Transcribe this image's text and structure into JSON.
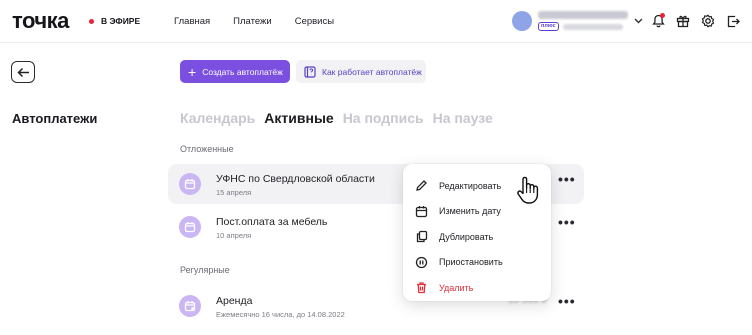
{
  "header": {
    "logo": "точка",
    "live_label": "В ЭФИРЕ",
    "nav": [
      "Главная",
      "Платежи",
      "Сервисы"
    ],
    "user": {
      "plan_badge": "плюс"
    }
  },
  "page": {
    "title": "Автоплатежи",
    "create_button": "Создать автоплатёж",
    "how_button": "Как работает автоплатёж"
  },
  "tabs": [
    {
      "label": "Календарь",
      "active": false
    },
    {
      "label": "Активные",
      "active": true
    },
    {
      "label": "На подпись",
      "active": false
    },
    {
      "label": "На паузе",
      "active": false
    }
  ],
  "sections": {
    "deferred": "Отложенные",
    "regular": "Регулярные"
  },
  "payments": [
    {
      "title": "УФНС по Свердловской области",
      "subtitle": "15 апреля",
      "amount": "00 000 ₽"
    },
    {
      "title": "Пост.оплата за мебель",
      "subtitle": "10 апреля",
      "amount": "00 000 ₽"
    },
    {
      "title": "Аренда",
      "subtitle": "Ежемесячно 16 числа, до 14.08.2022",
      "amount": "10 000 ₽"
    }
  ],
  "context_menu": {
    "items": [
      {
        "label": "Редактировать",
        "icon": "pencil-icon"
      },
      {
        "label": "Изменить дату",
        "icon": "calendar-icon"
      },
      {
        "label": "Дублировать",
        "icon": "copy-icon"
      },
      {
        "label": "Приостановить",
        "icon": "pause-icon"
      },
      {
        "label": "Удалить",
        "icon": "trash-icon"
      }
    ]
  },
  "colors": {
    "accent": "#7b4fe0",
    "icon_bg": "#c9b6f2",
    "danger": "#e0303a",
    "live_dot": "#e8243a"
  }
}
